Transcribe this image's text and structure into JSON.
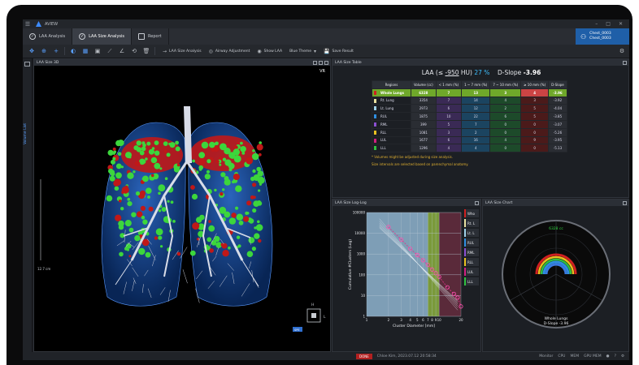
{
  "app": {
    "name": "AVIEW"
  },
  "tabs": [
    {
      "label": "LAA Analysis"
    },
    {
      "label": "LAA Size Analysis"
    },
    {
      "label": "Report"
    }
  ],
  "patient": {
    "line1": "Chest_0003",
    "line2": "Chest_0003"
  },
  "toolbar": {
    "laa_size_analysis": "LAA Size Analysis",
    "airway_adjust": "Airway Adjustment",
    "show_mask": "Show LAA",
    "theme": "Blue Theme",
    "save_result": "Save Result"
  },
  "rail": {
    "vertical_label": "Volume List"
  },
  "panel_3d": {
    "title": "LAA Size 3D",
    "vr": "VR",
    "scale_label": "12.7 cm",
    "orient_h": "H",
    "orient_l": "L",
    "orient_badge": "SPE"
  },
  "panel_table": {
    "title": "LAA Size Table",
    "laa_label": "LAA (≤",
    "laa_hu": "-950",
    "laa_unit": "HU)",
    "laa_pct": "27 %",
    "dslope_label": "D-Slope",
    "dslope_value": "-3.96",
    "headers": [
      "Regions",
      "Volume (cc)",
      "< 1 mm (%)",
      "1 ~ 7 mm (%)",
      "7 ~ 10 mm (%)",
      "≥ 10 mm (%)",
      "D-Slope"
    ],
    "rows": [
      {
        "region": "Whole Lungs",
        "volume": "6328",
        "a": "7",
        "b": "13",
        "c": "3",
        "d": "4",
        "ds": "-3.96",
        "color": "#d02020"
      },
      {
        "region": "Rt. Lung",
        "volume": "3354",
        "a": "7",
        "b": "14",
        "c": "4",
        "d": "3",
        "ds": "-3.92",
        "color": "#e8e0a0"
      },
      {
        "region": "Lt. Lung",
        "volume": "2973",
        "a": "6",
        "b": "12",
        "c": "2",
        "d": "5",
        "ds": "-4.04",
        "color": "#9fd0e8"
      },
      {
        "region": "RUL",
        "volume": "1875",
        "a": "10",
        "b": "22",
        "c": "6",
        "d": "5",
        "ds": "-3.85",
        "color": "#2f8ee0"
      },
      {
        "region": "RML",
        "volume": "399",
        "a": "5",
        "b": "7",
        "c": "0",
        "d": "0",
        "ds": "-3.07",
        "color": "#8a4fd0"
      },
      {
        "region": "RLL",
        "volume": "1081",
        "a": "3",
        "b": "2",
        "c": "0",
        "d": "0",
        "ds": "-5.26",
        "color": "#e8c020"
      },
      {
        "region": "LUL",
        "volume": "1677",
        "a": "6",
        "b": "16",
        "c": "4",
        "d": "9",
        "ds": "-3.95",
        "color": "#d02080"
      },
      {
        "region": "LLL",
        "volume": "1296",
        "a": "4",
        "b": "4",
        "c": "0",
        "d": "0",
        "ds": "-5.13",
        "color": "#30c040"
      }
    ],
    "note1": "* Volumes might be adjusted during size analysis.",
    "note2": "Size intervals are selected based on parenchymal anatomy."
  },
  "panel_loglog": {
    "title": "LAA Size Log-Log",
    "legend": [
      "Who",
      "Rt. L",
      "Lt. L",
      "RUL",
      "RML",
      "RLL",
      "LUL",
      "LLL"
    ],
    "legend_colors": [
      "#d02020",
      "#e8e0a0",
      "#9fd0e8",
      "#2f8ee0",
      "#8a4fd0",
      "#e8c020",
      "#d02080",
      "#30c040"
    ]
  },
  "chart_data": {
    "type": "scatter",
    "xlabel": "Cluster Diameter [mm]",
    "ylabel": "Cumulative #Clusters (Log)",
    "x_log": true,
    "y_log": true,
    "xlim": [
      1,
      20
    ],
    "ylim": [
      1,
      100000
    ],
    "x_ticks": [
      1,
      2,
      3,
      4,
      5,
      6,
      7,
      8,
      9,
      10,
      20
    ],
    "x_tick_labels": [
      "1",
      "2",
      "3",
      "4",
      "5",
      "6",
      "7",
      "8",
      "9",
      "10",
      "20"
    ],
    "y_ticks": [
      1,
      10,
      100,
      1000,
      10000,
      100000
    ],
    "series": [
      {
        "name": "Who",
        "x": [
          2,
          3,
          4,
          5,
          6,
          7,
          8,
          9,
          10,
          13,
          16,
          18,
          20
        ],
        "y": [
          20000,
          5000,
          1800,
          900,
          500,
          300,
          180,
          120,
          80,
          25,
          12,
          8,
          3
        ]
      }
    ]
  },
  "panel_chart": {
    "title": "LAA Size Chart",
    "volume": "6328 cc",
    "label1": "Whole Lungs",
    "label2": "D-Slope -3.96"
  },
  "status": {
    "done": "DONE",
    "user": "Chloe Kim, 2023.07.12 20:58:34",
    "items": [
      "Monitor",
      "CPU",
      "MEM",
      "GPU MEM"
    ]
  }
}
